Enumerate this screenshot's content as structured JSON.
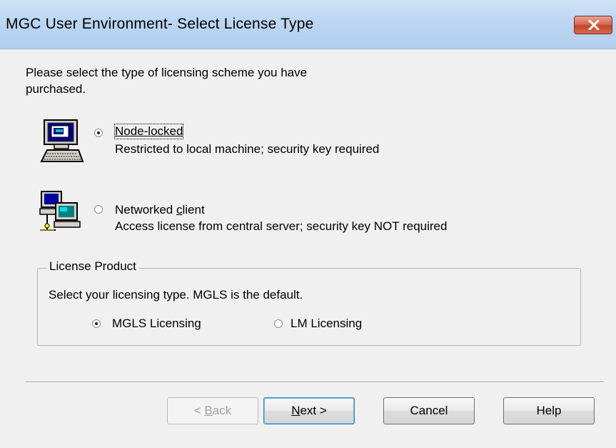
{
  "window": {
    "title": "MGC User Environment- Select License Type"
  },
  "intro": {
    "line1": "Please select the type of licensing scheme you have",
    "line2": "purchased."
  },
  "license_scheme": {
    "selected": "Node-locked",
    "options": [
      {
        "label_pre": "Node-locked",
        "description": "Restricted to local machine; security key required",
        "icon": "computer-icon",
        "checked": true
      },
      {
        "label_pre": "Networked ",
        "label_mnemonic": "c",
        "label_post": "lient",
        "description": "Access license from central server; security key NOT required",
        "icon": "network-computers-icon",
        "checked": false
      }
    ]
  },
  "license_product": {
    "legend": "License Product",
    "instruction": "Select your licensing type. MGLS is the default.",
    "options": [
      {
        "label": "MGLS Licensing",
        "checked": true
      },
      {
        "label": "LM Licensing",
        "checked": false
      }
    ]
  },
  "buttons": {
    "back_pre": "< ",
    "back_mnemonic": "B",
    "back_post": "ack",
    "next_mnemonic": "N",
    "next_post": "ext >",
    "cancel": "Cancel",
    "help": "Help"
  },
  "colors": {
    "dialog_bg": "#f0f0f0",
    "titlebar": "#bcd6f1",
    "close_button": "#c5432c"
  }
}
